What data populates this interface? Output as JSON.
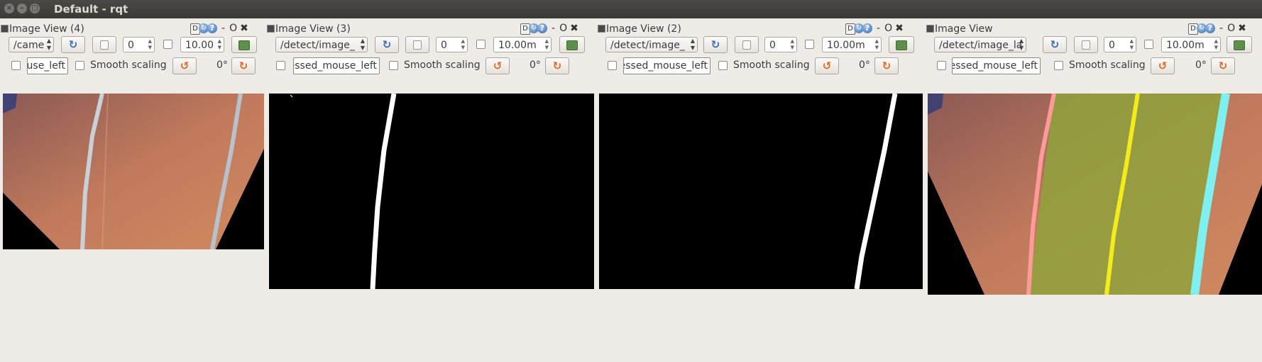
{
  "window": {
    "title": "Default - rqt"
  },
  "panels": [
    {
      "title": "Image View (4)",
      "topic": "/came",
      "spin_value": "0",
      "max_value": "10.00",
      "mouse_topic": "use_left",
      "smooth_label": "Smooth scaling",
      "rotation": "0°",
      "image_type": "camera"
    },
    {
      "title": "Image View (3)",
      "topic": "/detect/image_",
      "spin_value": "0",
      "max_value": "10.00m",
      "mouse_topic": "essed_mouse_left",
      "smooth_label": "Smooth scaling",
      "rotation": "0°",
      "image_type": "binary-left"
    },
    {
      "title": "Image View (2)",
      "topic": "/detect/image_",
      "spin_value": "0",
      "max_value": "10.00m",
      "mouse_topic": "essed_mouse_left",
      "smooth_label": "Smooth scaling",
      "rotation": "0°",
      "image_type": "binary-right"
    },
    {
      "title": "Image View",
      "topic": "/detect/image_la",
      "spin_value": "0",
      "max_value": "10.00m",
      "mouse_topic": "essed_mouse_left",
      "smooth_label": "Smooth scaling",
      "rotation": "0°",
      "image_type": "lane-overlay"
    }
  ],
  "icons": {
    "title_close": "close-icon",
    "title_minimize": "minimize-icon",
    "title_maximize": "maximize-icon",
    "dock_d": "D",
    "reload": "reload-icon",
    "help": "?",
    "float": "O",
    "close": "✖"
  },
  "colors": {
    "titlebar": "#3b3a36",
    "panel_bg": "#efebe7",
    "lane_yellow": "#f4ec1a",
    "lane_cyan": "#7ff0f0",
    "lane_pink": "#ff9a9a",
    "lane_overlay_green": "#8fa23c"
  }
}
